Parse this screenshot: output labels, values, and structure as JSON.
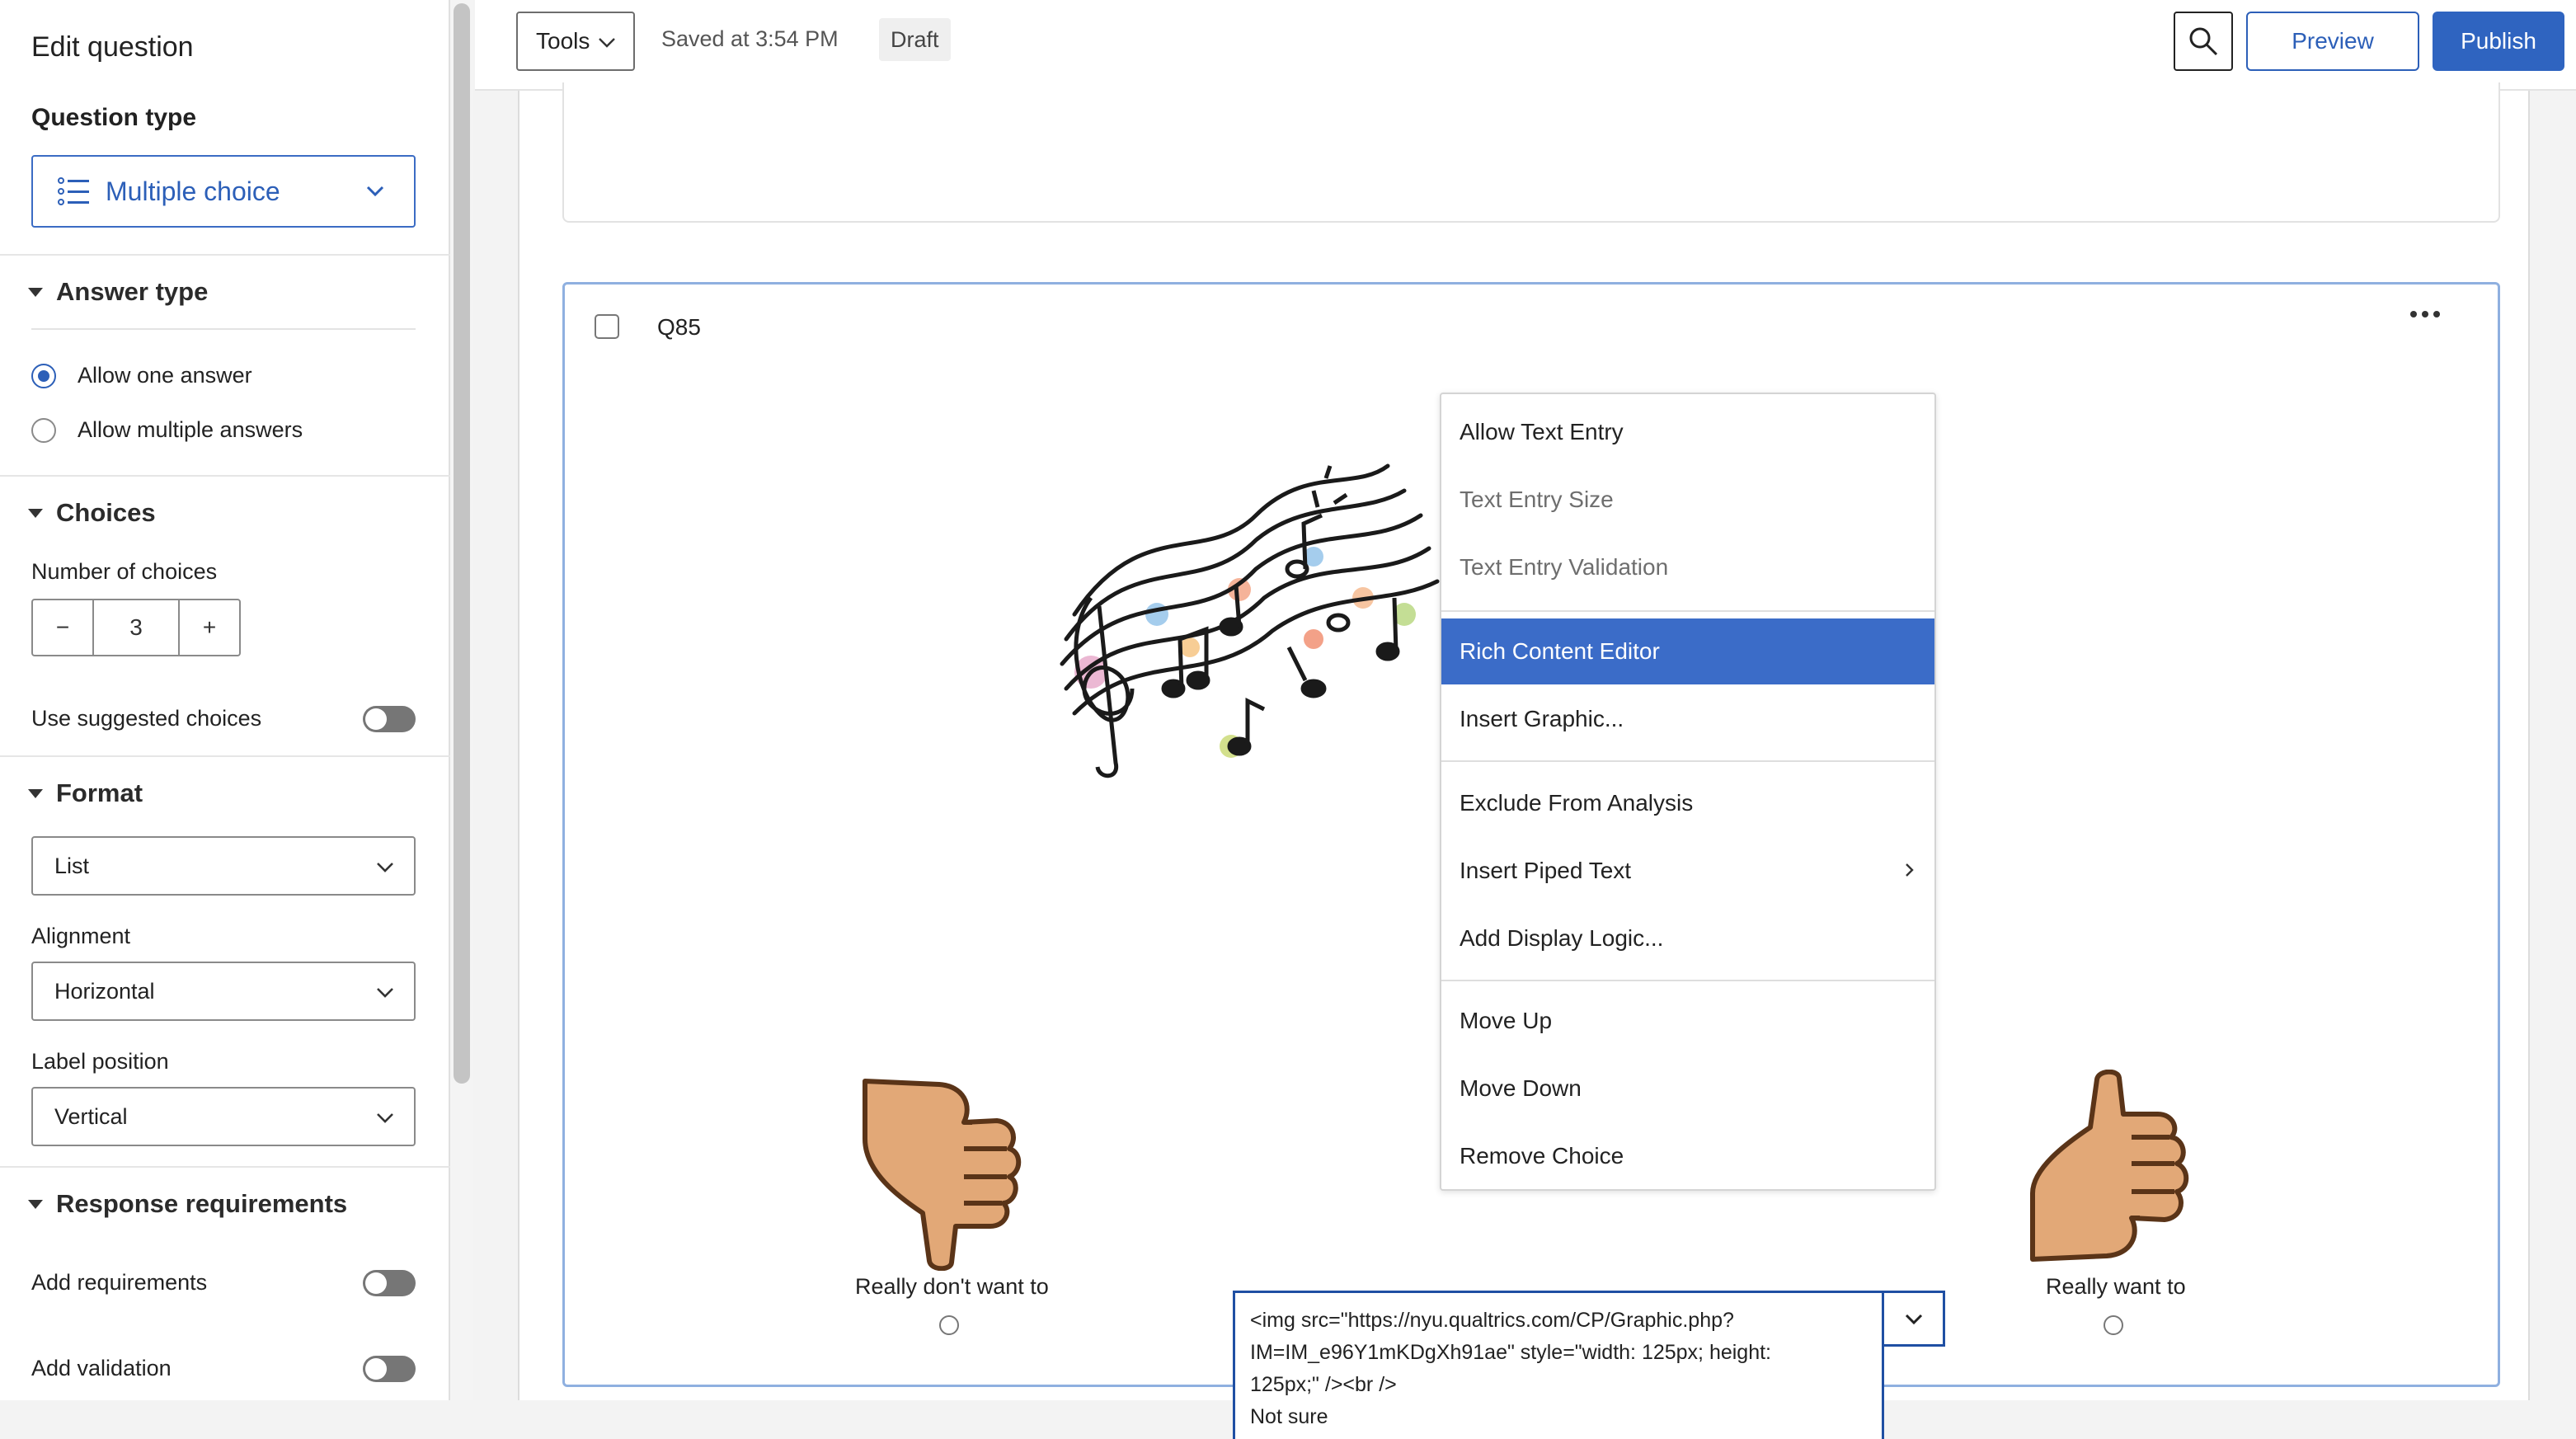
{
  "sidebar": {
    "title": "Edit question",
    "question_type_heading": "Question type",
    "question_type_value": "Multiple choice",
    "answer_type": {
      "heading": "Answer type",
      "options": [
        "Allow one answer",
        "Allow multiple answers"
      ],
      "selected_index": 0
    },
    "choices": {
      "heading": "Choices",
      "number_label": "Number of choices",
      "minus": "−",
      "count": "3",
      "plus": "+",
      "suggested_label": "Use suggested choices"
    },
    "format": {
      "heading": "Format",
      "format_value": "List",
      "alignment_label": "Alignment",
      "alignment_value": "Horizontal",
      "label_position_label": "Label position",
      "label_position_value": "Vertical"
    },
    "response": {
      "heading": "Response requirements",
      "add_requirements": "Add requirements",
      "add_validation": "Add validation"
    }
  },
  "topbar": {
    "tools_label": "Tools",
    "saved_text": "Saved at 3:54 PM",
    "status_badge": "Draft",
    "preview_label": "Preview",
    "publish_label": "Publish"
  },
  "question": {
    "id": "Q85",
    "choices": [
      {
        "label": "Really don't want to"
      },
      {
        "label": "Not sure"
      },
      {
        "label": "Really want to"
      }
    ],
    "editor_text_line1": "<img src=\"https://nyu.qualtrics.com/CP/Graphic.php?",
    "editor_text_line2": "IM=IM_e96Y1mKDgXh91ae\" style=\"width: 125px; height:",
    "editor_text_line3": "125px;\" /><br />",
    "editor_text_line4": "Not sure"
  },
  "context_menu": {
    "items": [
      {
        "label": "Allow Text Entry"
      },
      {
        "label": "Text Entry Size"
      },
      {
        "label": "Text Entry Validation"
      },
      {
        "label": "Rich Content Editor"
      },
      {
        "label": "Insert Graphic..."
      },
      {
        "label": "Exclude From Analysis"
      },
      {
        "label": "Insert Piped Text"
      },
      {
        "label": "Add Display Logic..."
      },
      {
        "label": "Move Up"
      },
      {
        "label": "Move Down"
      },
      {
        "label": "Remove Choice"
      }
    ],
    "highlighted": "Rich Content Editor"
  },
  "colors": {
    "accent": "#2f64c0",
    "highlight": "#3b6cc8",
    "card_border": "#8fb0e0"
  }
}
